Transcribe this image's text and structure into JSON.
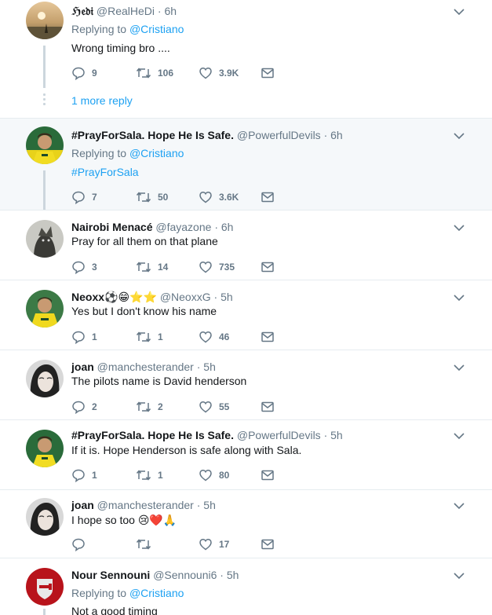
{
  "tweets": [
    {
      "name": "ℌ𝔢𝔡𝔦",
      "handle": "@RealHeDi",
      "time": "6h",
      "replying_label": "Replying to",
      "replying_to": "@Cristiano",
      "text": "Wrong timing bro ....",
      "replies": "9",
      "retweets": "106",
      "likes": "3.9K"
    },
    {
      "name": "#PrayForSala. Hope He Is Safe.",
      "handle": "@PowerfulDevils",
      "time": "6h",
      "replying_label": "Replying to",
      "replying_to": "@Cristiano",
      "text": "#PrayForSala",
      "replies": "7",
      "retweets": "50",
      "likes": "3.6K"
    },
    {
      "name": "Nairobi Menacé",
      "handle": "@fayazone",
      "time": "6h",
      "text": "Pray for all them on that plane",
      "replies": "3",
      "retweets": "14",
      "likes": "735"
    },
    {
      "name": "Neoxx⚽😁⭐⭐",
      "handle": "@NeoxxG",
      "time": "5h",
      "text": "Yes but I don't know his name",
      "replies": "1",
      "retweets": "1",
      "likes": "46"
    },
    {
      "name": "joan",
      "handle": "@manchesterander",
      "time": "5h",
      "text": "The pilots name is David henderson",
      "replies": "2",
      "retweets": "2",
      "likes": "55"
    },
    {
      "name": "#PrayForSala. Hope He Is Safe.",
      "handle": "@PowerfulDevils",
      "time": "5h",
      "text": "If it is. Hope Henderson is safe along with Sala.",
      "replies": "1",
      "retweets": "1",
      "likes": "80"
    },
    {
      "name": "joan",
      "handle": "@manchesterander",
      "time": "5h",
      "text": "I hope so too 😢❤️🙏",
      "replies": "",
      "retweets": "",
      "likes": "17"
    },
    {
      "name": "Nour Sennouni",
      "handle": "@Sennouni6",
      "time": "5h",
      "replying_label": "Replying to",
      "replying_to": "@Cristiano",
      "text": "Not a good timing"
    }
  ],
  "more_replies": "1 more reply",
  "dot_separator": "·",
  "colors": {
    "accent": "#1da1f2",
    "muted": "#657786",
    "thread": "#ccd6dd",
    "highlight_bg": "#f5f8fa"
  },
  "icons": [
    "reply-icon",
    "retweet-icon",
    "like-icon",
    "message-icon",
    "chevron-down-icon"
  ]
}
